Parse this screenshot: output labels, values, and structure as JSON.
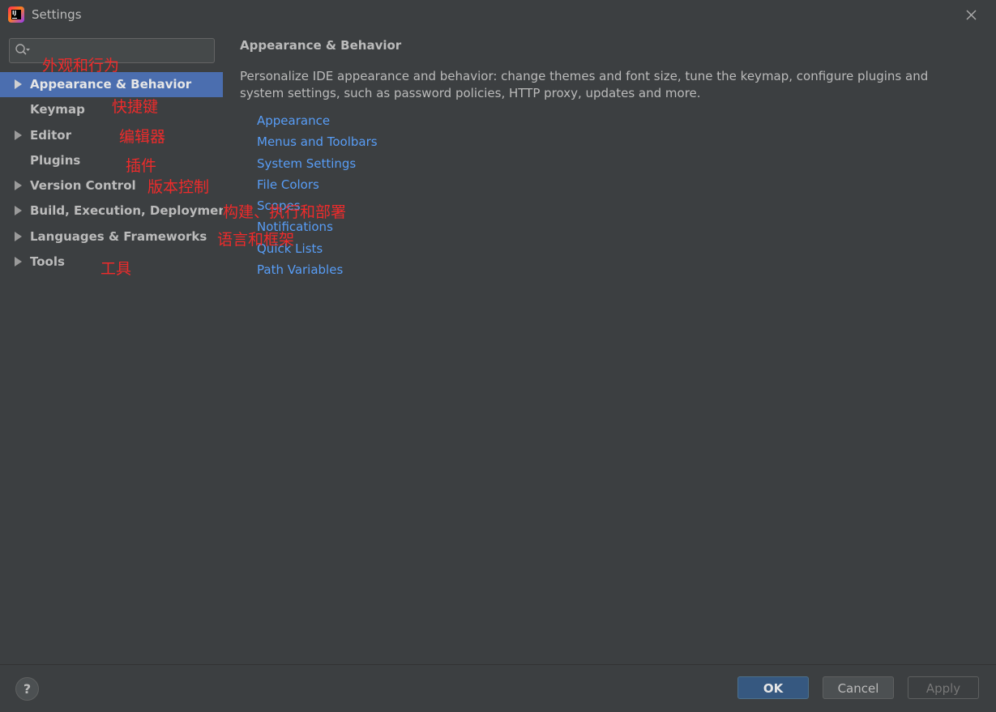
{
  "window": {
    "title": "Settings",
    "app_icon_text": "IJ"
  },
  "search": {
    "placeholder": "",
    "value": ""
  },
  "sidebar": {
    "items": [
      {
        "label": "Appearance & Behavior",
        "expandable": true,
        "selected": true
      },
      {
        "label": "Keymap",
        "expandable": false,
        "selected": false
      },
      {
        "label": "Editor",
        "expandable": true,
        "selected": false
      },
      {
        "label": "Plugins",
        "expandable": false,
        "selected": false
      },
      {
        "label": "Version Control",
        "expandable": true,
        "selected": false
      },
      {
        "label": "Build, Execution, Deployment",
        "expandable": true,
        "selected": false
      },
      {
        "label": "Languages & Frameworks",
        "expandable": true,
        "selected": false
      },
      {
        "label": "Tools",
        "expandable": true,
        "selected": false
      }
    ]
  },
  "annotations": [
    "外观和行为",
    "快捷键",
    "编辑器",
    "插件",
    "版本控制",
    "构建、执行和部署",
    "语言和框架",
    "工具"
  ],
  "main": {
    "title": "Appearance & Behavior",
    "description": "Personalize IDE appearance and behavior: change themes and font size, tune the keymap, configure plugins and system settings, such as password policies, HTTP proxy, updates and more.",
    "links": [
      "Appearance",
      "Menus and Toolbars",
      "System Settings",
      "File Colors",
      "Scopes",
      "Notifications",
      "Quick Lists",
      "Path Variables"
    ]
  },
  "footer": {
    "help_label": "?",
    "ok_label": "OK",
    "cancel_label": "Cancel",
    "apply_label": "Apply"
  },
  "colors": {
    "background": "#3c3f41",
    "selection": "#4b6eaf",
    "link": "#589df6",
    "annotation": "#ee2b2b",
    "ok_button": "#365880"
  }
}
